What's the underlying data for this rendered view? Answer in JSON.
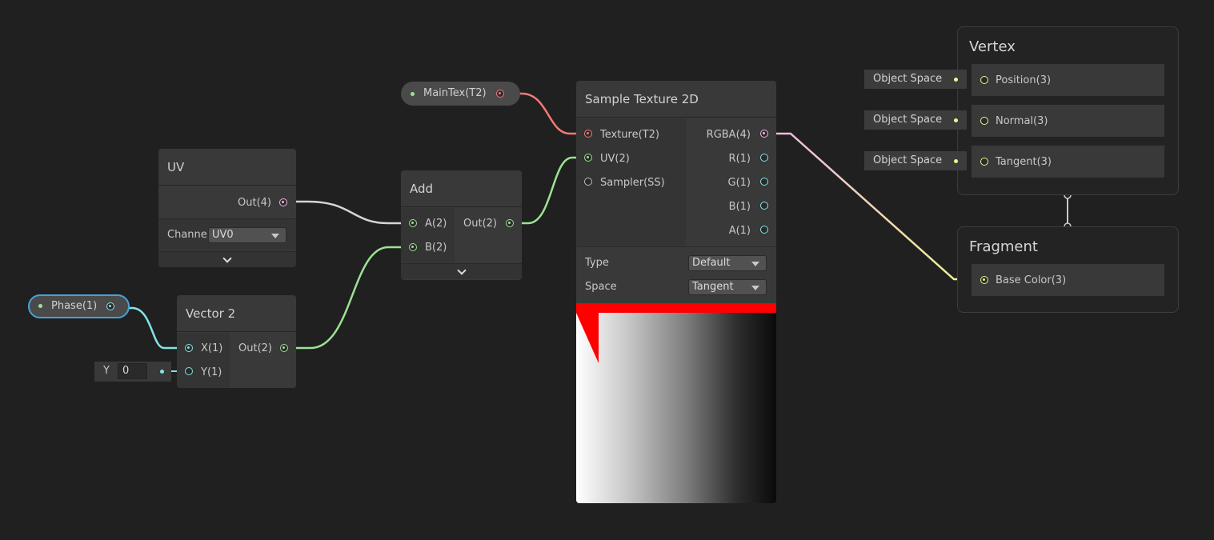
{
  "colors": {
    "background": "#202020",
    "node": "#393939",
    "vector2_wire": "#9ce293",
    "vector4_wire": "#f2b8e3",
    "texture_wire": "#f17a7a",
    "float_wire": "#84e4e7",
    "vector3_wire": "#eef48d"
  },
  "properties": {
    "maintex": {
      "label": "MainTex(T2)"
    },
    "phase": {
      "label": "Phase(1)"
    }
  },
  "uv_node": {
    "title": "UV",
    "out_label": "Out(4)",
    "channel_label": "Channe",
    "channel_value": "UV0"
  },
  "add_node": {
    "title": "Add",
    "inputs": [
      "A(2)",
      "B(2)"
    ],
    "out_label": "Out(2)"
  },
  "vector2_node": {
    "title": "Vector 2",
    "inputs": [
      "X(1)",
      "Y(1)"
    ],
    "out_label": "Out(2)",
    "y_field_label": "Y",
    "y_field_value": "0"
  },
  "sample_node": {
    "title": "Sample Texture 2D",
    "inputs": [
      "Texture(T2)",
      "UV(2)",
      "Sampler(SS)"
    ],
    "outputs": [
      "RGBA(4)",
      "R(1)",
      "G(1)",
      "B(1)",
      "A(1)"
    ],
    "type_label": "Type",
    "type_value": "Default",
    "space_label": "Space",
    "space_value": "Tangent"
  },
  "vertex_context": {
    "title": "Vertex",
    "slots": [
      {
        "label": "Position(3)",
        "space": "Object Space"
      },
      {
        "label": "Normal(3)",
        "space": "Object Space"
      },
      {
        "label": "Tangent(3)",
        "space": "Object Space"
      }
    ]
  },
  "fragment_context": {
    "title": "Fragment",
    "slots": [
      {
        "label": "Base Color(3)"
      }
    ]
  }
}
